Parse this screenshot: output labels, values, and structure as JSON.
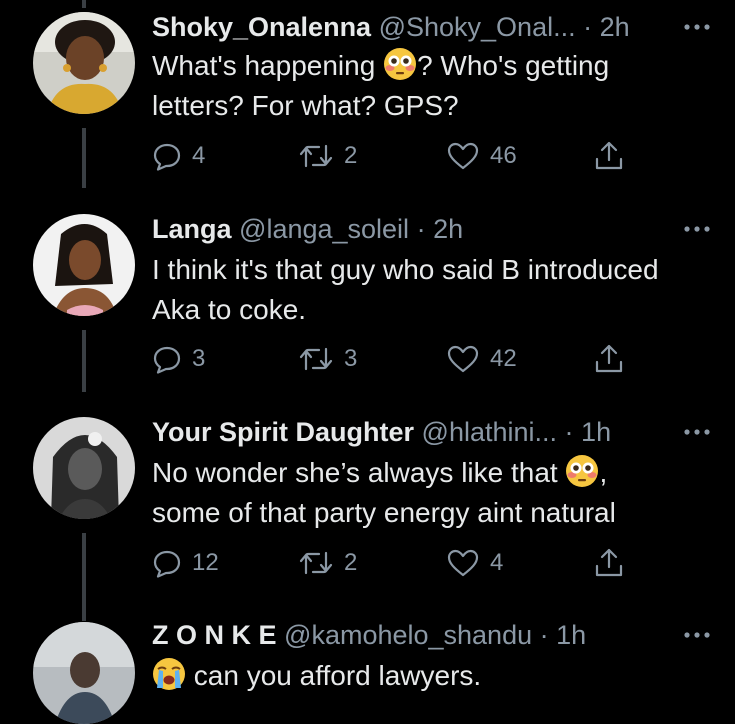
{
  "colors": {
    "background": "#000000",
    "text": "#e7e9ea",
    "secondary": "#8b98a5",
    "thread_line": "#3a3f44"
  },
  "tweets": [
    {
      "display_name": "Shoky_Onalenna",
      "handle": "@Shoky_Onal...",
      "separator": "·",
      "time": "2h",
      "text_line1_a": "What's happening ",
      "text_line1_emoji": "flushed-face-emoji",
      "text_line1_b": "? Who's getting",
      "text_line2": "letters? For what? GPS?",
      "replies": "4",
      "retweets": "2",
      "likes": "46"
    },
    {
      "display_name": "Langa",
      "handle": "@langa_soleil",
      "separator": "·",
      "time": "2h",
      "text_line1": "I think it's that guy who said B introduced",
      "text_line2": "Aka to coke.",
      "replies": "3",
      "retweets": "3",
      "likes": "42"
    },
    {
      "display_name": "Your Spirit Daughter",
      "handle": "@hlathini...",
      "separator": "·",
      "time": "1h",
      "text_line1_a": "No wonder she’s always like that ",
      "text_line1_emoji": "flushed-face-emoji",
      "text_line1_b": ",",
      "text_line2": "some of that party energy aint natural",
      "replies": "12",
      "retweets": "2",
      "likes": "4"
    },
    {
      "display_name": "Z O N K E",
      "handle": "@kamohelo_shandu",
      "separator": "·",
      "time": "1h",
      "text_line1_emoji": "loudly-crying-face-emoji",
      "text_line1": " can you afford lawyers."
    }
  ]
}
